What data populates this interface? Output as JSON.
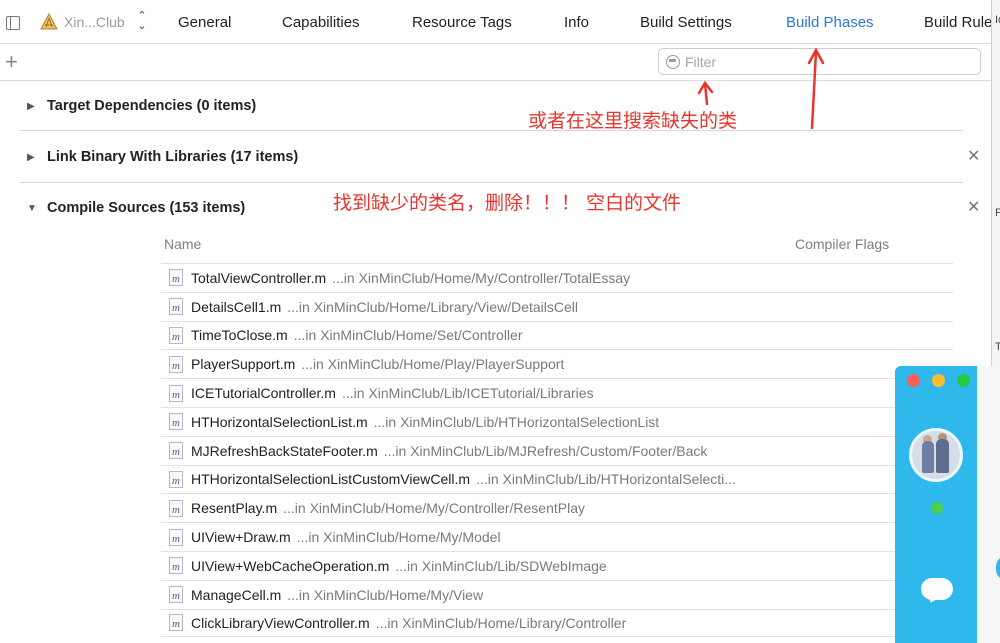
{
  "tabbar": {
    "target_name": "Xin...Club",
    "tabs": [
      "General",
      "Capabilities",
      "Resource Tags",
      "Info",
      "Build Settings",
      "Build Phases",
      "Build Rule"
    ],
    "active_tab": "Build Phases",
    "active_color": "#2a78d2"
  },
  "filter": {
    "placeholder": "Filter"
  },
  "phases": {
    "target_dependencies": "Target Dependencies (0 items)",
    "link_binary": "Link Binary With Libraries (17 items)",
    "compile_sources": "Compile Sources (153 items)"
  },
  "columns": {
    "name": "Name",
    "compiler_flags": "Compiler Flags"
  },
  "files": [
    {
      "name": "TotalViewController.m",
      "path": "...in XinMinClub/Home/My/Controller/TotalEssay"
    },
    {
      "name": "DetailsCell1.m",
      "path": "...in XinMinClub/Home/Library/View/DetailsCell"
    },
    {
      "name": "TimeToClose.m",
      "path": "...in XinMinClub/Home/Set/Controller"
    },
    {
      "name": "PlayerSupport.m",
      "path": "...in XinMinClub/Home/Play/PlayerSupport"
    },
    {
      "name": "ICETutorialController.m",
      "path": "...in XinMinClub/Lib/ICETutorial/Libraries"
    },
    {
      "name": "HTHorizontalSelectionList.m",
      "path": "...in XinMinClub/Lib/HTHorizontalSelectionList"
    },
    {
      "name": "MJRefreshBackStateFooter.m",
      "path": "...in XinMinClub/Lib/MJRefresh/Custom/Footer/Back"
    },
    {
      "name": "HTHorizontalSelectionListCustomViewCell.m",
      "path": "...in XinMinClub/Lib/HTHorizontalSelecti..."
    },
    {
      "name": "ResentPlay.m",
      "path": "...in XinMinClub/Home/My/Controller/ResentPlay"
    },
    {
      "name": "UIView+Draw.m",
      "path": "...in XinMinClub/Home/My/Model"
    },
    {
      "name": "UIView+WebCacheOperation.m",
      "path": "...in XinMinClub/Lib/SDWebImage"
    },
    {
      "name": "ManageCell.m",
      "path": "...in XinMinClub/Home/My/View"
    },
    {
      "name": "ClickLibraryViewController.m",
      "path": "...in XinMinClub/Home/Library/Controller"
    }
  ],
  "annotations": {
    "search_hint": "或者在这里搜索缺失的类",
    "delete_hint": "找到缺少的类名，删除！！！ 空白的文件",
    "color": "#e8362e"
  },
  "inspector": {
    "marks": [
      "Id",
      "P",
      "T"
    ]
  },
  "chat": {
    "bg_color": "#2fb8ec",
    "traffic_colors": [
      "#fc5f57",
      "#fdbc2e",
      "#28c840"
    ],
    "status_color": "#4cd04c"
  }
}
